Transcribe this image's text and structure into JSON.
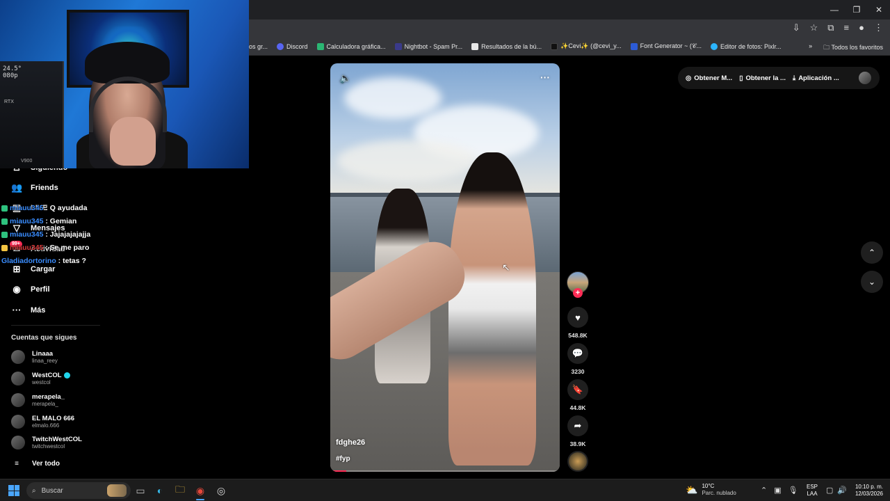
{
  "browser": {
    "bookmarks": [
      {
        "label": "os gr...",
        "color": "#8a8a8a"
      },
      {
        "label": "Discord",
        "color": "#5865f2"
      },
      {
        "label": "Calculadora gráfica...",
        "color": "#2bb673"
      },
      {
        "label": "Nightbot - Spam Pr...",
        "color": "#3a3a8a"
      },
      {
        "label": "Resultados de la bú...",
        "color": "#e8e8e8"
      },
      {
        "label": "✨Cevi✨ (@cevi_y...",
        "color": "#111111"
      },
      {
        "label": "Font Generator ~ (𝒞...",
        "color": "#2c5bd6"
      },
      {
        "label": "Editor de fotos: Pixlr...",
        "color": "#2bb5ff"
      }
    ],
    "all_favorites": "Todos los favoritos"
  },
  "sidebar": {
    "items": [
      {
        "label": "Siguiendo",
        "icon": "following-icon"
      },
      {
        "label": "Friends",
        "icon": "friends-icon"
      },
      {
        "label": "LIVE",
        "icon": "live-icon"
      },
      {
        "label": "Mensajes",
        "icon": "messages-icon"
      },
      {
        "label": "Actividad",
        "icon": "activity-icon",
        "badge": "99+"
      },
      {
        "label": "Cargar",
        "icon": "upload-icon"
      },
      {
        "label": "Perfil",
        "icon": "profile-icon"
      },
      {
        "label": "Más",
        "icon": "more-icon"
      }
    ],
    "following_title": "Cuentas que sigues",
    "accounts": [
      {
        "name": "Linaaa",
        "handle": "linaa_reey"
      },
      {
        "name": "WestCOL",
        "handle": "westcol",
        "verified": true
      },
      {
        "name": "merapela_",
        "handle": "merapela_"
      },
      {
        "name": "EL MALO 666",
        "handle": "elmalo.666"
      },
      {
        "name": "TwitchWestCOL",
        "handle": "twitchwestcol"
      }
    ],
    "see_all": "Ver todo"
  },
  "chat": [
    {
      "user": "miauu345",
      "text": ": Q ayudada",
      "badge_color": "#2ec27e"
    },
    {
      "user": "miauu345",
      "text": ": Gemian",
      "badge_color": "#2ec27e"
    },
    {
      "user": "miauu345",
      "text": ": Jajajajajajja",
      "badge_color": "#2ec27e"
    },
    {
      "user": "miauu345",
      "text": ": Se me paro",
      "badge_color": "#f5c542"
    },
    {
      "user": "Gladiadortorino",
      "text": ": tetas ?",
      "badge_color": ""
    }
  ],
  "webcam": {
    "pc_line1": "24.5°",
    "pc_line2": "080p",
    "pc_brand": "RTX",
    "pc_model": "V900"
  },
  "video": {
    "author": "fdghe26",
    "hashtag": "#fyp",
    "progress_fraction": 0.07,
    "likes": "548.8K",
    "comments": "3230",
    "saves": "44.8K",
    "shares": "38.9K"
  },
  "top_pill": {
    "item1": "Obtener M...",
    "item2": "Obtener la ...",
    "item3": "Aplicación ..."
  },
  "taskbar": {
    "search_label": "Buscar",
    "temp": "10°C",
    "weather": "Parc. nublado",
    "lang1": "ESP",
    "lang2": "LAA",
    "time": "10:10 p. m.",
    "date": "12/03/2026"
  }
}
